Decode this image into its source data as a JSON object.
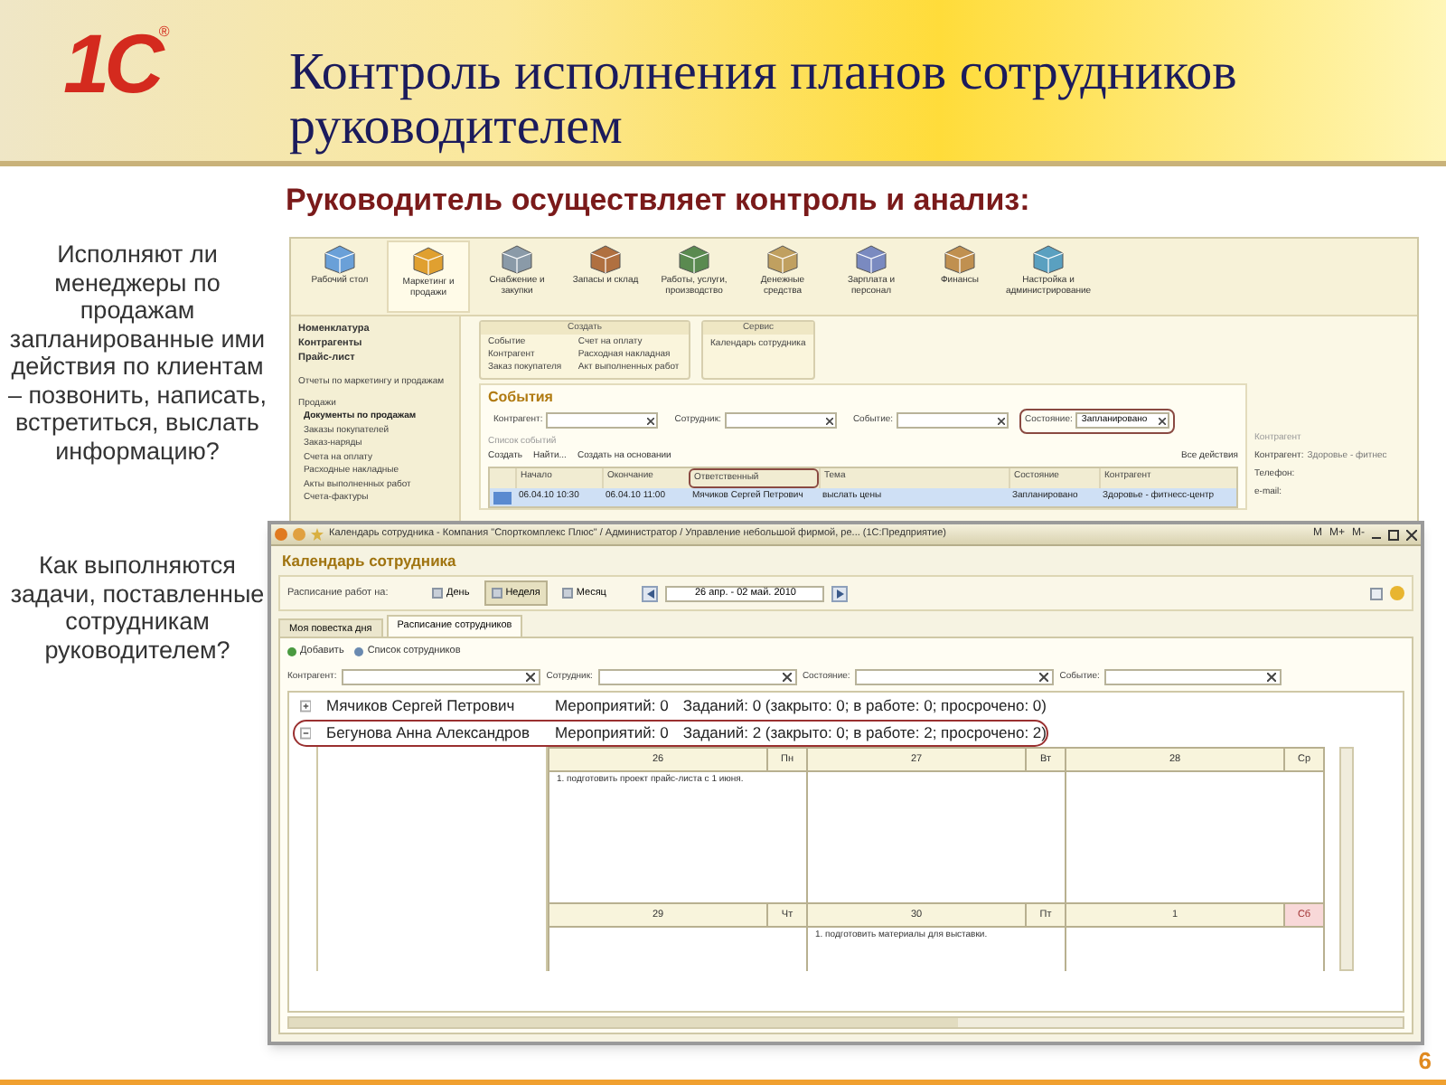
{
  "logo": {
    "text": "1С",
    "mark": "®"
  },
  "title": {
    "lines": [
      "Контроль исполнения планов сотрудников",
      "руководителем"
    ]
  },
  "subtitle": "Руководитель осуществляет контроль и анализ:",
  "questions": [
    "Исполняют ли менеджеры по продажам запланированные ими действия по клиентам – позвонить, написать, встретиться, выслать информацию?",
    "Как выполняются задачи, поставленные сотрудникам руководителем?"
  ],
  "app": {
    "sections": [
      {
        "label": "Рабочий стол",
        "selected": false
      },
      {
        "label": "Маркетинг и продажи",
        "selected": true
      },
      {
        "label": "Снабжение и закупки",
        "selected": false
      },
      {
        "label": "Запасы и склад",
        "selected": false
      },
      {
        "label": "Работы, услуги, производство",
        "selected": false
      },
      {
        "label": "Денежные средства",
        "selected": false
      },
      {
        "label": "Зарплата и персонал",
        "selected": false
      },
      {
        "label": "Финансы",
        "selected": false
      },
      {
        "label": "Настройка и администрирование",
        "selected": false
      }
    ],
    "nav_top": [
      "Номенклатура",
      "Контрагенты",
      "Прайс-лист"
    ],
    "nav_report": "Отчеты по маркетингу и продажам",
    "nav_group": "Продажи",
    "nav_items": [
      {
        "label": "Документы по продажам",
        "selected": true
      },
      {
        "label": "Заказы покупателей",
        "selected": false
      },
      {
        "label": "Заказ-наряды",
        "selected": false
      },
      {
        "label": "Счета на оплату",
        "selected": false
      },
      {
        "label": "Расходные накладные",
        "selected": false
      },
      {
        "label": "Акты выполненных работ",
        "selected": false
      },
      {
        "label": "Счета-фактуры",
        "selected": false
      }
    ],
    "create_panel": {
      "title": "Создать",
      "links": [
        "Событие",
        "Контрагент",
        "Заказ покупателя",
        "Счет на оплату",
        "Расходная накладная",
        "Акт выполненных работ"
      ]
    },
    "service_panel": {
      "title": "Сервис",
      "links": [
        "Календарь сотрудника"
      ]
    },
    "events": {
      "title": "События",
      "filters": [
        {
          "label": "Контрагент:",
          "highlighted": false
        },
        {
          "label": "Сотрудник:",
          "highlighted": false
        },
        {
          "label": "Событие:",
          "highlighted": false
        },
        {
          "label": "Состояние:",
          "value": "Запланировано",
          "highlighted": true
        }
      ],
      "list_title": "Список событий",
      "toolbar": [
        "Создать",
        "Найти...",
        "Создать на основании"
      ],
      "all_actions": "Все действия",
      "columns": [
        {
          "label": "Начало",
          "highlighted": false
        },
        {
          "label": "Окончание",
          "highlighted": false
        },
        {
          "label": "Ответственный",
          "highlighted": true
        },
        {
          "label": "Тема",
          "highlighted": false
        },
        {
          "label": "Состояние",
          "highlighted": false
        },
        {
          "label": "Контрагент",
          "highlighted": false
        }
      ],
      "rows": [
        {
          "selected": true,
          "cells": [
            "06.04.10 10:30",
            "06.04.10 11:00",
            "Мячиков Сергей Петрович",
            "выслать цены",
            "Запланировано",
            "Здоровье - фитнесс-центр"
          ]
        }
      ],
      "side": {
        "title": "Контрагент",
        "fields": [
          "Контрагент:",
          "Телефон:",
          "e-mail:"
        ],
        "value": "Здоровье - фитнес"
      }
    }
  },
  "calendar": {
    "window_title": "Календарь сотрудника - Компания \"Спорткомплекс Плюс\" / Администратор / Управление небольшой фирмой, ре... (1С:Предприятие)",
    "title_buttons": [
      "M",
      "M+",
      "M-"
    ],
    "heading": "Календарь сотрудника",
    "schedule_label": "Расписание работ на:",
    "views": [
      {
        "label": "День",
        "selected": false
      },
      {
        "label": "Неделя",
        "selected": true
      },
      {
        "label": "Месяц",
        "selected": false
      }
    ],
    "period": "26 апр. - 02 май. 2010",
    "tabs": [
      {
        "label": "Моя повестка дня",
        "selected": false
      },
      {
        "label": "Расписание сотрудников",
        "selected": true
      }
    ],
    "toolbar": [
      "Добавить",
      "Список сотрудников"
    ],
    "filters": [
      "Контрагент:",
      "Сотрудник:",
      "Состояние:",
      "Событие:"
    ],
    "employees": [
      {
        "name": "Мячиков Сергей Петрович",
        "events": "Мероприятий: 0",
        "tasks": "Заданий: 0 (закрыто: 0; в работе: 0; просрочено: 0)",
        "expanded": false,
        "highlighted": false
      },
      {
        "name": "Бегунова Анна Александров",
        "events": "Мероприятий: 0",
        "tasks": "Заданий: 2 (закрыто: 0; в работе: 2; просрочено: 2)",
        "expanded": true,
        "highlighted": true
      }
    ],
    "days": [
      {
        "number": "26",
        "weekday": "Пн",
        "weekend": false,
        "tasks": [
          "1. подготовить проект прайс-листа с 1 июня."
        ]
      },
      {
        "number": "27",
        "weekday": "Вт",
        "weekend": false
      },
      {
        "number": "28",
        "weekday": "Ср",
        "weekend": false
      },
      {
        "number": "29",
        "weekday": "Чт",
        "weekend": false
      },
      {
        "number": "30",
        "weekday": "Пт",
        "weekend": false,
        "tasks": [
          "1. подготовить материалы для выставки."
        ]
      },
      {
        "number": "1",
        "weekday": "Сб",
        "weekend": true
      }
    ]
  },
  "page_number": "6"
}
